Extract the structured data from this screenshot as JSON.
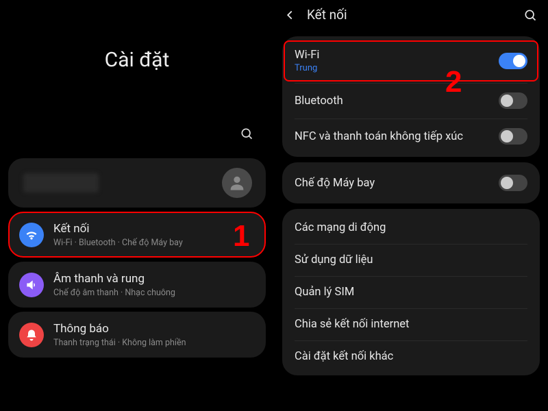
{
  "left": {
    "page_title": "Cài đặt",
    "items": [
      {
        "title": "Kết nối",
        "subtitle": "Wi-Fi · Bluetooth · Chế độ Máy bay",
        "highlighted": true
      },
      {
        "title": "Âm thanh và rung",
        "subtitle": "Chế độ âm thanh · Nhạc chuông"
      },
      {
        "title": "Thông báo",
        "subtitle": "Thanh trạng thái · Không làm phiền"
      }
    ]
  },
  "right": {
    "header_title": "Kết nối",
    "groups": [
      [
        {
          "title": "Wi-Fi",
          "sub": "Trung",
          "toggle": "on",
          "highlighted": true
        },
        {
          "title": "Bluetooth",
          "toggle": "off"
        },
        {
          "title": "NFC và thanh toán không tiếp xúc",
          "toggle": "off"
        }
      ],
      [
        {
          "title": "Chế độ Máy bay",
          "toggle": "off"
        }
      ],
      [
        {
          "title": "Các mạng di động"
        },
        {
          "title": "Sử dụng dữ liệu"
        },
        {
          "title": "Quản lý SIM"
        },
        {
          "title": "Chia sẻ kết nối internet"
        },
        {
          "title": "Cài đặt kết nối khác"
        }
      ]
    ]
  },
  "annotations": {
    "one": "1",
    "two": "2"
  },
  "colors": {
    "accent": "#3b82f6",
    "danger": "#ff0000"
  }
}
